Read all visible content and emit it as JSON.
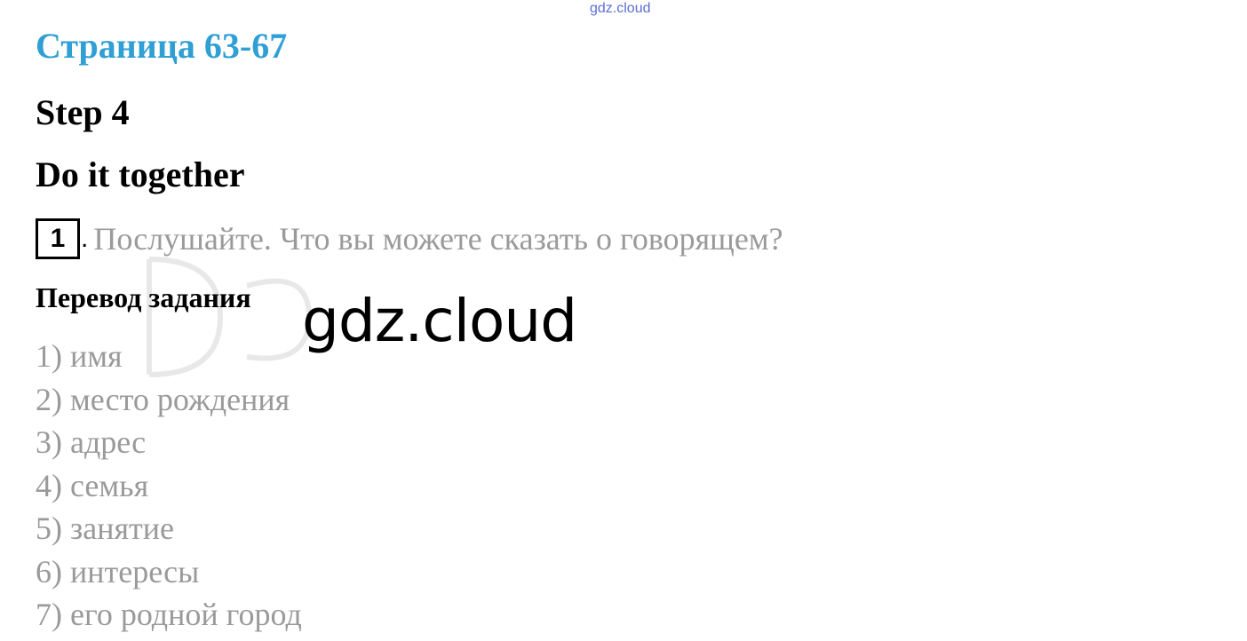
{
  "watermark": {
    "top": "gdz.cloud",
    "center": "gdz.cloud"
  },
  "page": {
    "title": "Страница 63-67",
    "step": "Step 4",
    "section": "Do it together"
  },
  "task": {
    "number": "1",
    "text": "Послушайте. Что вы можете сказать о говорящем?"
  },
  "translation": {
    "heading": "Перевод задания"
  },
  "answers": [
    "1) имя",
    "2) место рождения",
    "3) адрес",
    "4) семья",
    "5) занятие",
    "6) интересы",
    "7) его родной город"
  ],
  "colors": {
    "title": "#2f9fd4",
    "gray_text": "#9a9a9a",
    "watermark_top": "#5b6fd6"
  }
}
